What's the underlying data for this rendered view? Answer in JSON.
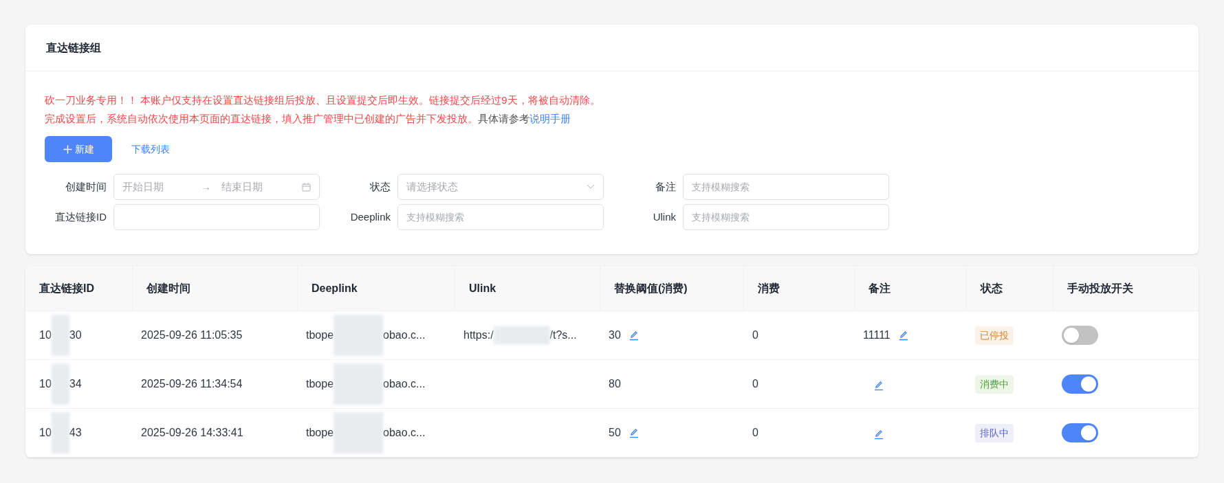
{
  "panel": {
    "title": "直达链接组",
    "notice": {
      "line1": "砍一刀业务专用！！ 本账户仅支持在设置直达链接组后投放、且设置提交后即生效。链接提交后经过9天，将被自动清除。",
      "line2": "完成设置后，系统自动依次使用本页面的直达链接，填入推广管理中已创建的广告并下发投放。",
      "line2_tail": "具体请参考",
      "link": "说明手册"
    },
    "new_button": "新建",
    "download_link": "下载列表",
    "filters": {
      "created_label": "创建时间",
      "start_placeholder": "开始日期",
      "arrow": "→",
      "end_placeholder": "结束日期",
      "status_label": "状态",
      "status_placeholder": "请选择状态",
      "remark_label": "备注",
      "remark_placeholder": "支持模糊搜索",
      "id_label": "直达链接ID",
      "deeplink_label": "Deeplink",
      "deeplink_placeholder": "支持模糊搜索",
      "ulink_label": "Ulink",
      "ulink_placeholder": "支持模糊搜索"
    }
  },
  "table": {
    "columns": [
      "直达链接ID",
      "创建时间",
      "Deeplink",
      "Ulink",
      "替换阈值(消费)",
      "消费",
      "备注",
      "状态",
      "手动投放开关"
    ],
    "rows": [
      {
        "id_start": "10",
        "id_end": "30",
        "created": "2025-09-26 11:05:35",
        "deeplink_start": "tbope",
        "deeplink_end": "obao.c...",
        "ulink_start": "https:/",
        "ulink_end": "/t?s...",
        "threshold": "30",
        "threshold_editable": true,
        "spend": "0",
        "remark": "11111",
        "status": {
          "text": "已停投",
          "color": "#d9822b"
        },
        "on": false
      },
      {
        "id_start": "10",
        "id_end": "34",
        "created": "2025-09-26 11:34:54",
        "deeplink_start": "tbope",
        "deeplink_end": "obao.c...",
        "threshold": "80",
        "threshold_editable": false,
        "spend": "0",
        "status": {
          "text": "消费中",
          "color": "#4ca82a"
        },
        "on": true
      },
      {
        "id_start": "10",
        "id_end": "43",
        "created": "2025-09-26 14:33:41",
        "deeplink_start": "tbope",
        "deeplink_end": "obao.c...",
        "threshold": "50",
        "threshold_editable": true,
        "spend": "0",
        "status": {
          "text": "排队中",
          "color": "#5a64c8"
        },
        "on": true
      }
    ]
  }
}
